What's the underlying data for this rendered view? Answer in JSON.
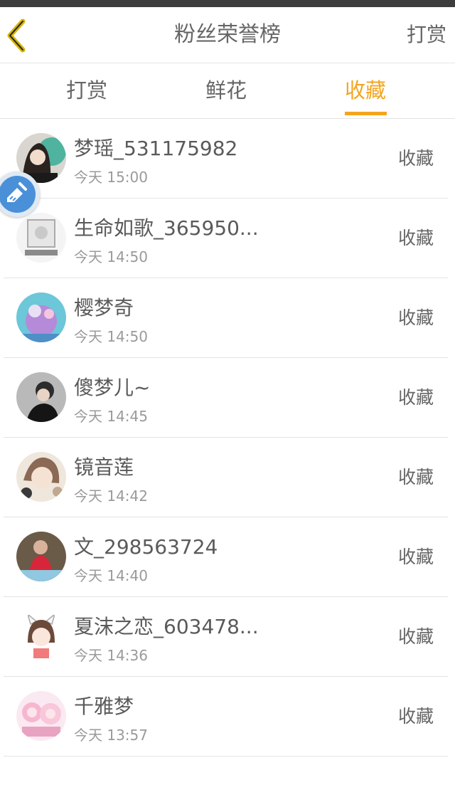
{
  "header": {
    "title": "粉丝荣誉榜",
    "back_icon": "chevron-left-icon",
    "action_label": "打赏",
    "accent_color": "#f3a51f"
  },
  "tabs": [
    {
      "label": "打赏",
      "active": false
    },
    {
      "label": "鲜花",
      "active": false
    },
    {
      "label": "收藏",
      "active": true
    }
  ],
  "fans": [
    {
      "name": "梦瑶_531175982",
      "time": "今天 15:00",
      "action": "收藏"
    },
    {
      "name": "生命如歌_365950...",
      "time": "今天 14:50",
      "action": "收藏"
    },
    {
      "name": "樱梦奇",
      "time": "今天 14:50",
      "action": "收藏"
    },
    {
      "name": "傻梦儿~",
      "time": "今天 14:45",
      "action": "收藏"
    },
    {
      "name": "镜音莲",
      "time": "今天 14:42",
      "action": "收藏"
    },
    {
      "name": "文_298563724",
      "time": "今天 14:40",
      "action": "收藏"
    },
    {
      "name": "夏沫之恋_603478...",
      "time": "今天 14:36",
      "action": "收藏"
    },
    {
      "name": "千雅梦",
      "time": "今天 13:57",
      "action": "收藏"
    }
  ],
  "floating_button": {
    "icon": "broom-icon"
  }
}
